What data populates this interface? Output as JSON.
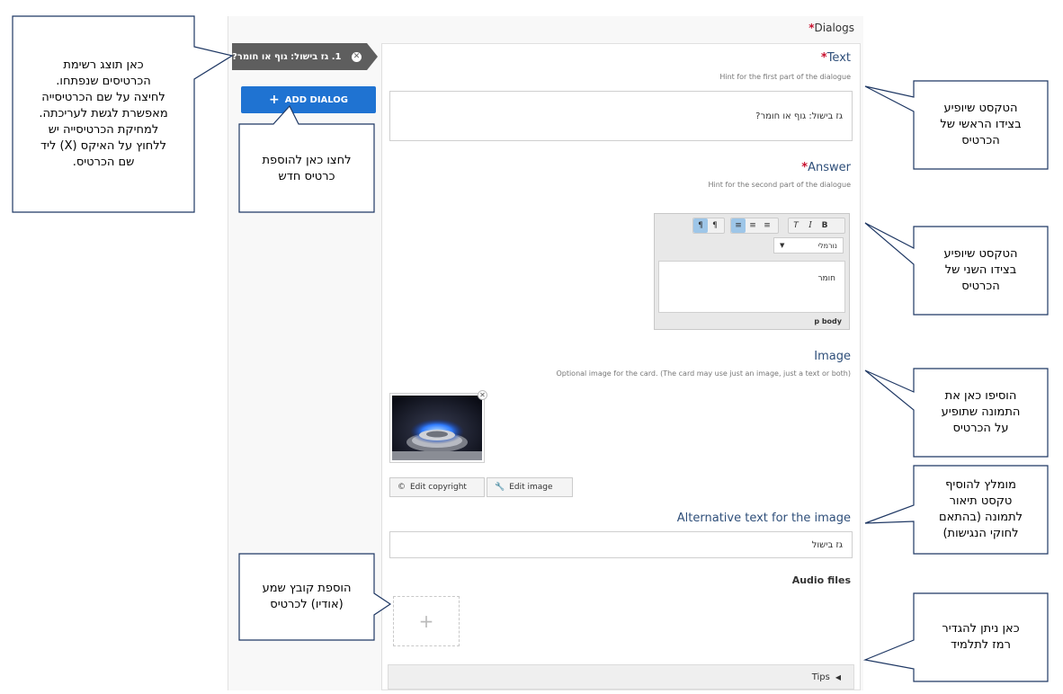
{
  "editor": {
    "dialogs_label": "Dialogs",
    "dialog_item_label": "1. גז בישול: גוף או חומר?",
    "add_dialog_label": "ADD DIALOG",
    "text_field": {
      "title": "Text",
      "hint": "Hint for the first part of the dialogue",
      "value": "גז בישול: גוף או חומר?"
    },
    "answer_field": {
      "title": "Answer",
      "hint": "Hint for the second part of the dialogue",
      "format_select": "נורמלי",
      "body_text": "חומר",
      "path": "p  body"
    },
    "image_field": {
      "title": "Image",
      "hint": "Optional image for the card. (The card may use just an image, just a text or both)",
      "edit_copyright_label": "Edit copyright",
      "edit_image_label": "Edit image"
    },
    "alt_text_field": {
      "title": "Alternative text for the image",
      "value": "גז בישול"
    },
    "audio_field": {
      "title": "Audio files"
    },
    "tips_label": "Tips"
  },
  "callouts": {
    "list": "כאן תוצג רשימת\nהכרטיסים שנפתחו.\nלחיצה על שם הכרטיסייה\nמאפשרת לגשת לעריכתה.\nלמחיקת הכרטיסייה יש\nללחוץ על האיקס (X) ליד\nשם הכרטיס.",
    "add_card": "לחצו כאן להוספת\nכרטיס חדש",
    "first_side": "הטקסט שיופיע\nבצידו הראשי של\nהכרטיס",
    "second_side": "הטקסט שיופיע\nבצידו השני של\nהכרטיס",
    "image": "הוסיפו כאן את\nהתמונה שתופיע\nעל הכרטיס",
    "alt_text": "מומלץ להוסיף\nטקסט תיאור\nלתמונה (בהתאם\nלחוקי הנגישות)",
    "audio": "הוספת קובץ שמע\n(אודיו) לכרטיס",
    "tips": "כאן ניתן להגדיר\nרמז לתלמיד"
  },
  "colors": {
    "accent": "#1f73d2",
    "required": "#c8102e",
    "field_title": "#2f4f7a",
    "callout_border": "#1f3864"
  }
}
